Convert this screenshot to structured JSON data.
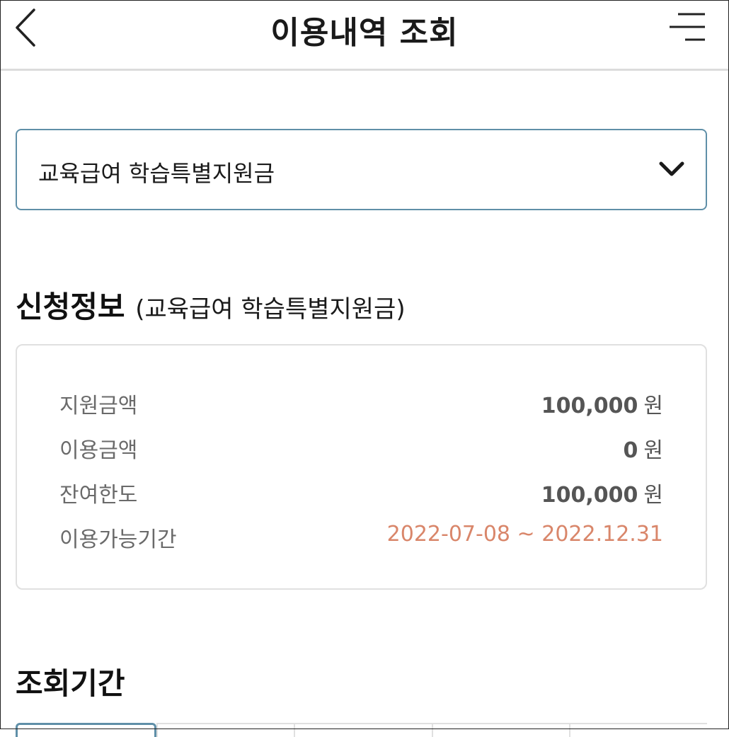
{
  "header": {
    "title": "이용내역 조회",
    "back_icon": "chevron-left-icon",
    "menu_icon": "menu-icon"
  },
  "select": {
    "value": "교육급여 학습특별지원금",
    "icon": "chevron-down-icon"
  },
  "application_info": {
    "title": "신청정보",
    "subtitle": "(교육급여 학습특별지원금)",
    "rows": [
      {
        "label": "지원금액",
        "value": "100,000",
        "unit": "원"
      },
      {
        "label": "이용금액",
        "value": "0",
        "unit": "원"
      },
      {
        "label": "잔여한도",
        "value": "100,000",
        "unit": "원"
      },
      {
        "label": "이용가능기간",
        "value": "2022-07-08 ~ 2022.12.31"
      }
    ]
  },
  "inquiry_period": {
    "title": "조회기간"
  },
  "colors": {
    "accent_border": "#5f8fa8",
    "period_text": "#d9866a"
  }
}
